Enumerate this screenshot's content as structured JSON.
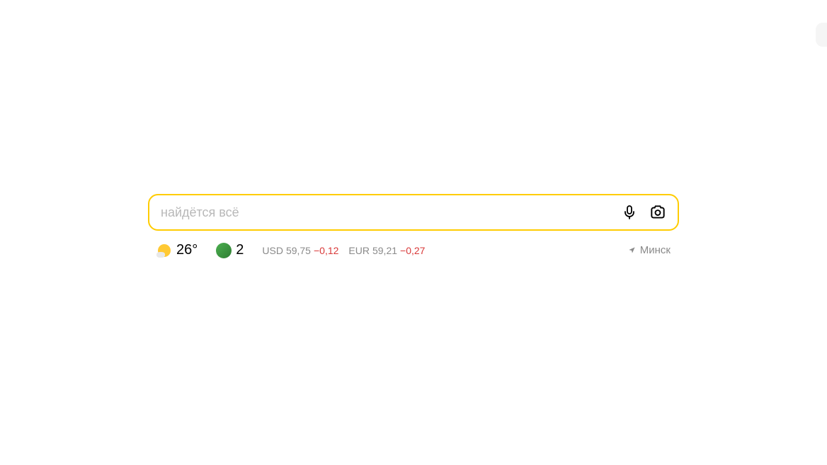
{
  "search": {
    "placeholder": "найдётся всё",
    "value": ""
  },
  "weather": {
    "temperature": "26°"
  },
  "traffic": {
    "level": "2"
  },
  "rates": {
    "usd": {
      "code": "USD",
      "value": "59,75",
      "change": "−0,12"
    },
    "eur": {
      "code": "EUR",
      "value": "59,21",
      "change": "−0,27"
    }
  },
  "location": {
    "city": "Минск"
  }
}
